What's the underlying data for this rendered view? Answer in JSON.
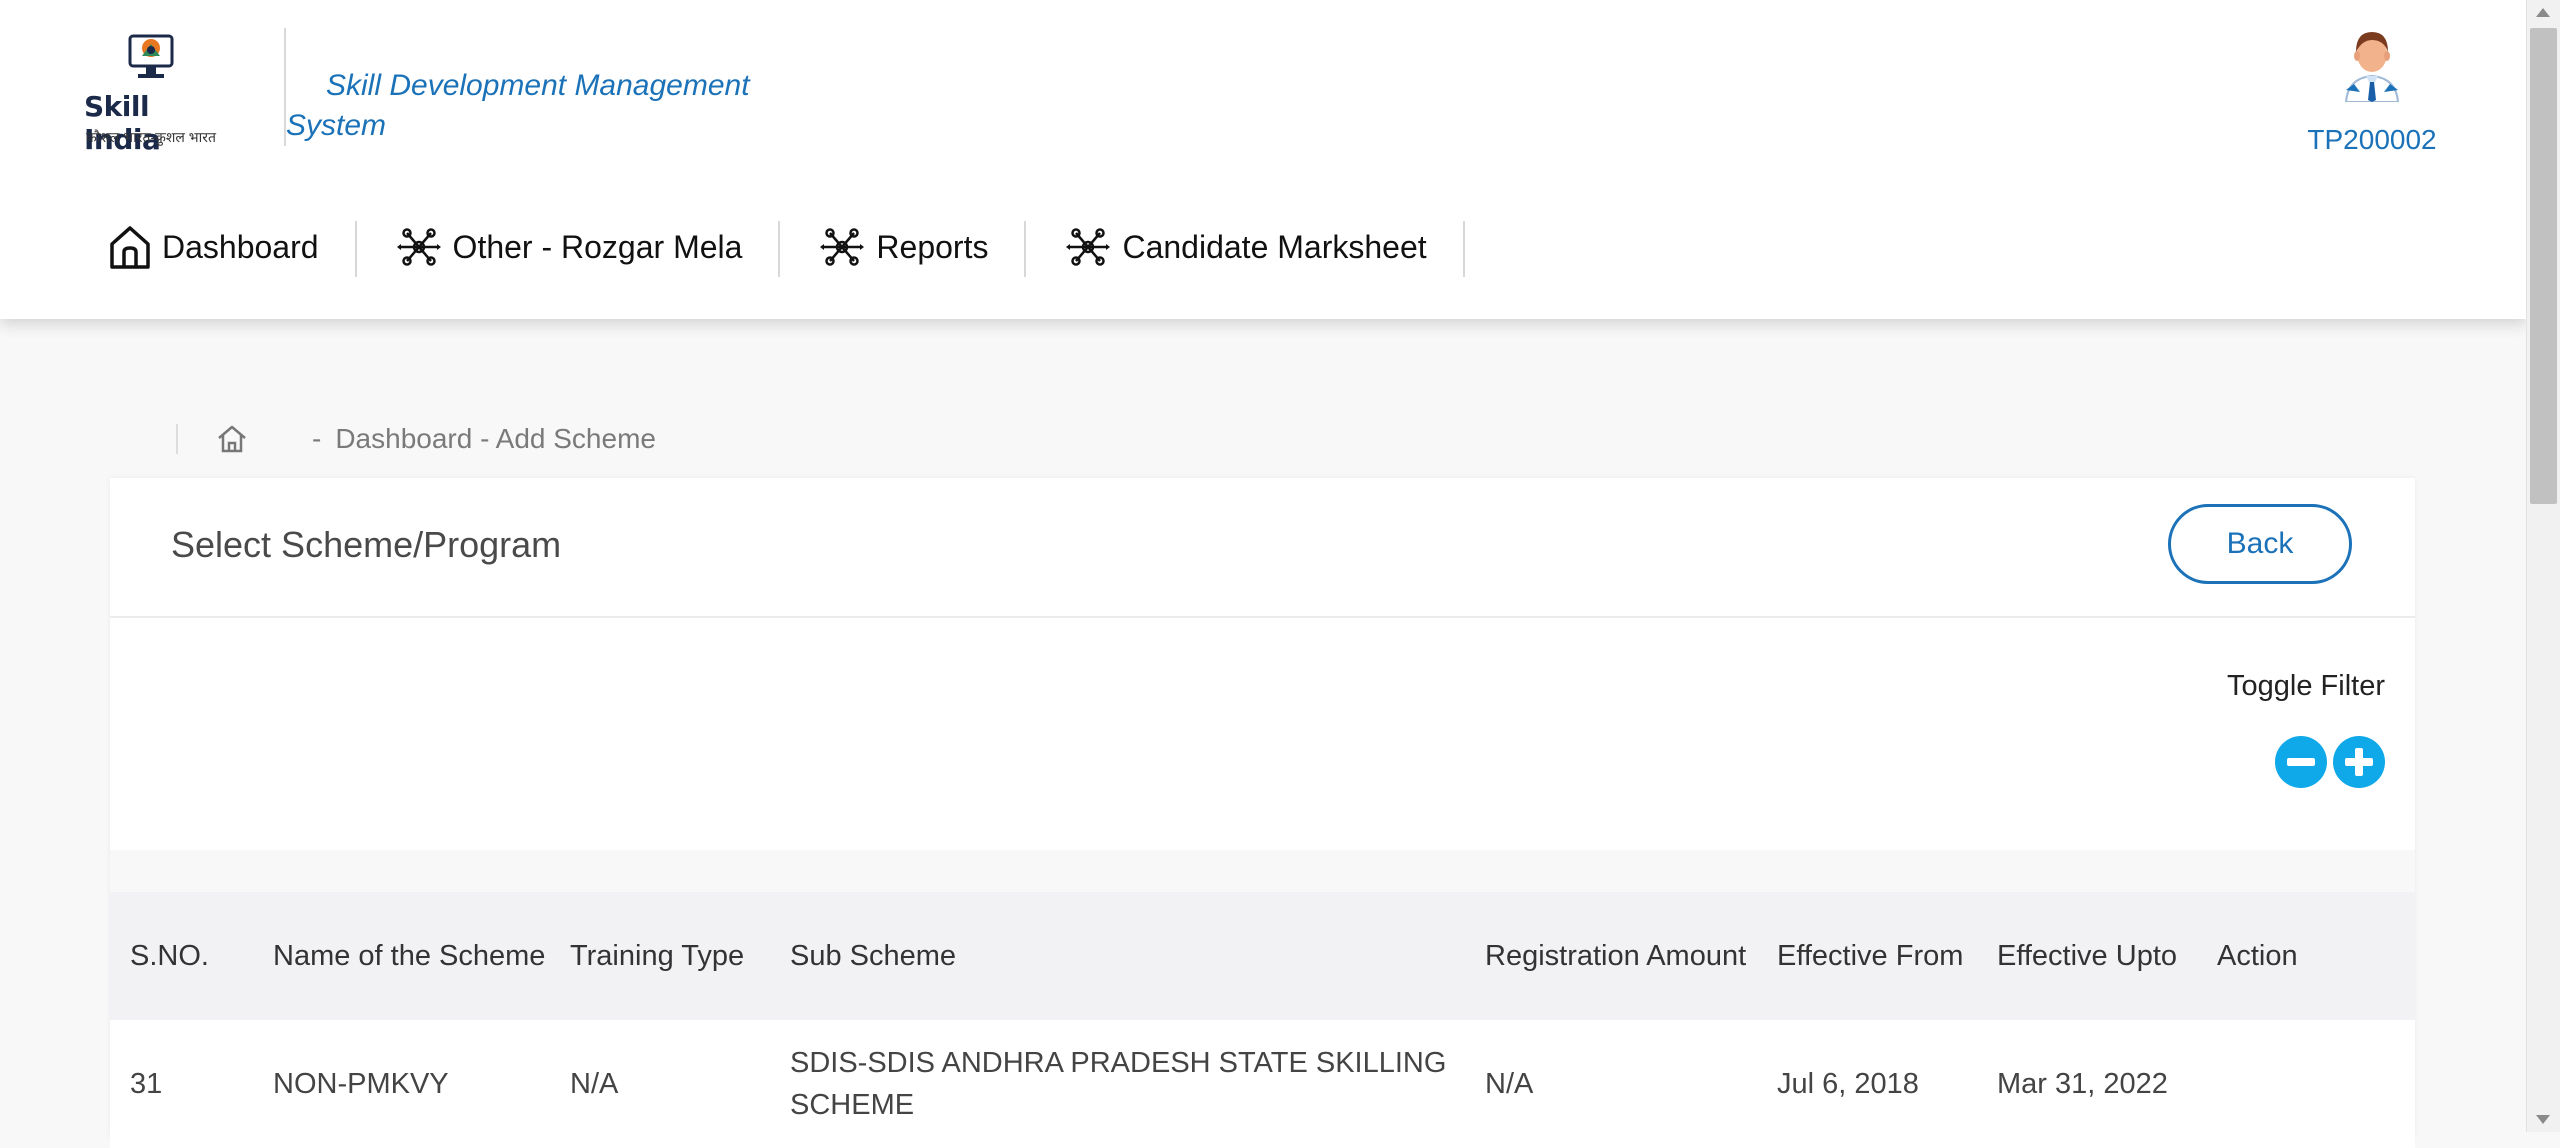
{
  "header": {
    "logo": {
      "name": "Skill India",
      "tagline": "कौशल भारत-कुशल भारत"
    },
    "app_title": "Skill Development Management System",
    "user_id": "TP200002"
  },
  "nav": [
    {
      "label": "Dashboard",
      "icon": "home-icon"
    },
    {
      "label": "Other - Rozgar Mela",
      "icon": "network-icon"
    },
    {
      "label": "Reports",
      "icon": "network-icon"
    },
    {
      "label": "Candidate Marksheet",
      "icon": "network-icon"
    }
  ],
  "breadcrumb": {
    "separator": "-",
    "path": "Dashboard - Add Scheme"
  },
  "card": {
    "title": "Select Scheme/Program",
    "back_label": "Back",
    "toggle_filter_label": "Toggle Filter"
  },
  "table": {
    "headers": [
      "S.NO.",
      "Name of the Scheme",
      "Training Type",
      "Sub Scheme",
      "Registration Amount",
      "Effective From",
      "Effective Upto",
      "Action"
    ],
    "rows": [
      [
        "31",
        "NON-PMKVY",
        "N/A",
        "SDIS-SDIS ANDHRA PRADESH STATE SKILLING SCHEME",
        "N/A",
        "Jul 6, 2018",
        "Mar 31, 2022",
        ""
      ]
    ]
  },
  "colors": {
    "accent": "#1b72b8",
    "toggle": "#0fa8e8"
  }
}
